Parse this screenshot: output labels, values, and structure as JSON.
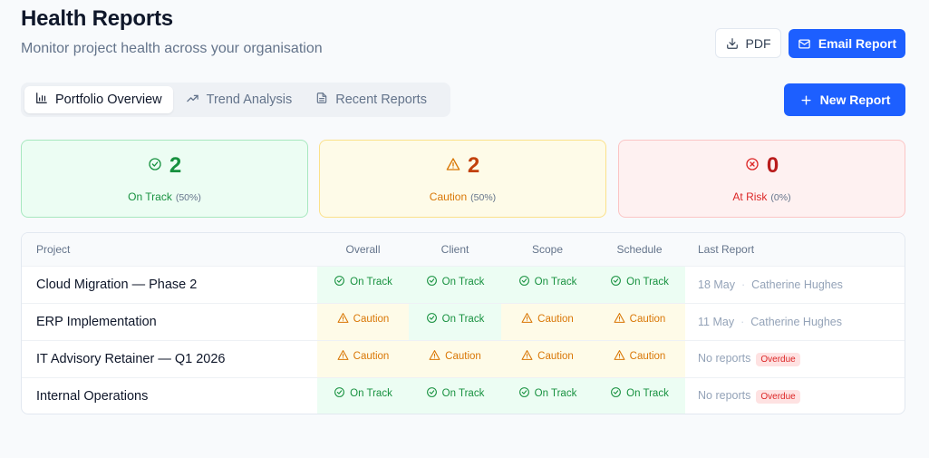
{
  "header": {
    "title": "Health Reports",
    "subtitle": "Monitor project health across your organisation"
  },
  "actions": {
    "pdf_label": "PDF",
    "email_label": "Email Report",
    "new_report_label": "New Report"
  },
  "tabs": [
    {
      "label": "Portfolio Overview",
      "icon": "bar-chart-icon",
      "active": true
    },
    {
      "label": "Trend Analysis",
      "icon": "trending-up-icon",
      "active": false
    },
    {
      "label": "Recent Reports",
      "icon": "document-icon",
      "active": false
    }
  ],
  "summary": {
    "on_track": {
      "count": "2",
      "label": "On Track",
      "pct": "(50%)",
      "icon": "check-circle-icon"
    },
    "caution": {
      "count": "2",
      "label": "Caution",
      "pct": "(50%)",
      "icon": "warning-triangle-icon"
    },
    "at_risk": {
      "count": "0",
      "label": "At Risk",
      "pct": "(0%)",
      "icon": "x-circle-icon"
    }
  },
  "table": {
    "headers": {
      "project": "Project",
      "overall": "Overall",
      "client": "Client",
      "scope": "Scope",
      "schedule": "Schedule",
      "last_report": "Last Report"
    },
    "status_labels": {
      "on_track": "On Track",
      "caution": "Caution"
    },
    "rows": [
      {
        "project": "Cloud Migration — Phase 2",
        "overall": "On Track",
        "client": "On Track",
        "scope": "On Track",
        "schedule": "On Track",
        "last_date": "18 May",
        "separator": "·",
        "last_author": "Catherine Hughes"
      },
      {
        "project": "ERP Implementation",
        "overall": "Caution",
        "client": "On Track",
        "scope": "Caution",
        "schedule": "Caution",
        "last_date": "11 May",
        "separator": "·",
        "last_author": "Catherine Hughes"
      },
      {
        "project": "IT Advisory Retainer — Q1 2026",
        "overall": "Caution",
        "client": "Caution",
        "scope": "Caution",
        "schedule": "Caution",
        "last_text": "No reports",
        "badge": "Overdue"
      },
      {
        "project": "Internal Operations",
        "overall": "On Track",
        "client": "On Track",
        "scope": "On Track",
        "schedule": "On Track",
        "last_text": "No reports",
        "badge": "Overdue"
      }
    ]
  },
  "colors": {
    "primary": "#1d5fff",
    "on_track": "#17913f",
    "caution": "#d97706",
    "at_risk": "#dc2626"
  }
}
